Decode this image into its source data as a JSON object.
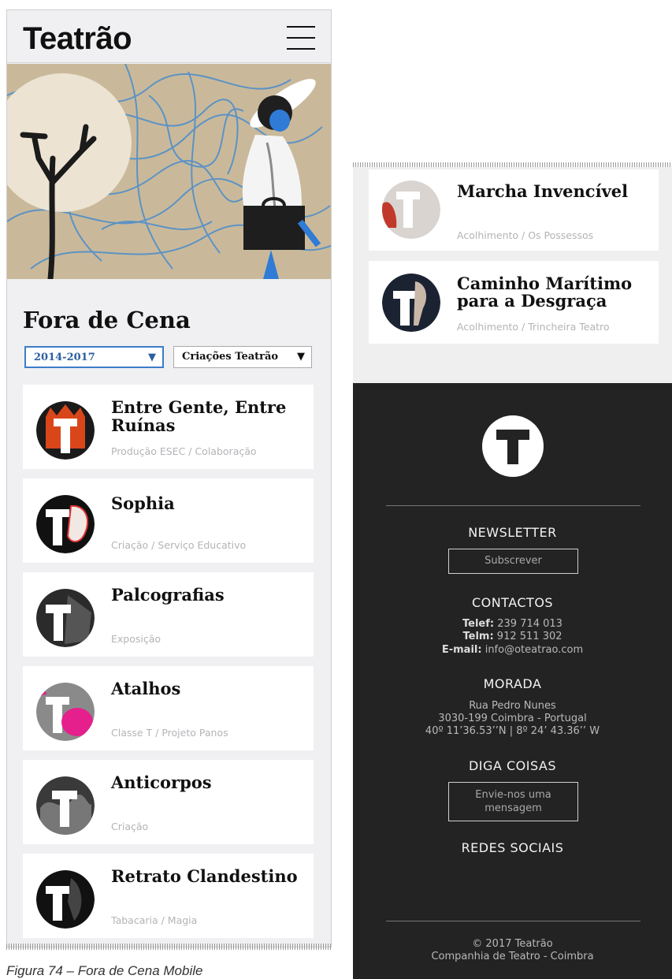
{
  "header": {
    "logo": "Teatrão",
    "menu_icon": "hamburger-menu-icon"
  },
  "section": {
    "title": "Fora de Cena"
  },
  "filters": {
    "years": {
      "value": "2014-2017",
      "arrow": "▼"
    },
    "category": {
      "value": "Criações Teatrão",
      "arrow": "▼"
    }
  },
  "cards": [
    {
      "title_line1": "Entre Gente, Entre",
      "title_line2": "Ruínas",
      "subtitle": "Produção ESEC / Colaboração"
    },
    {
      "title_line1": "Sophia",
      "subtitle": "Criação / Serviço Educativo"
    },
    {
      "title_line1": "Palcografias",
      "subtitle": "Exposição"
    },
    {
      "title_line1": "Atalhos",
      "subtitle": "Classe T / Projeto Panos"
    },
    {
      "title_line1": "Anticorpos",
      "subtitle": "Criação"
    },
    {
      "title_line1": "Retrato Clandestino",
      "subtitle": "Tabacaria / Magia"
    }
  ],
  "caption": "Figura 74 – Fora de Cena Mobile",
  "right_cards": [
    {
      "title_line1": "Marcha Invencível",
      "subtitle": "Acolhimento / Os Possessos"
    },
    {
      "title_line1": "Caminho Marítimo",
      "title_line2": "para a Desgraça",
      "subtitle": "Acolhimento / Trincheira Teatro"
    }
  ],
  "footer": {
    "newsletter": {
      "heading": "NEWSLETTER",
      "button": "Subscrever"
    },
    "contacts": {
      "heading": "CONTACTOS",
      "phone_label": "Telef:",
      "phone": "239 714 013",
      "mobile_label": "Telm:",
      "mobile": "912 511 302",
      "email_label": "E-mail:",
      "email": "info@oteatrao.com"
    },
    "address": {
      "heading": "MORADA",
      "line1": "Rua Pedro Nunes",
      "line2": "3030-199 Coimbra - Portugal",
      "line3": "40º 11’36.53’’N | 8º 24’ 43.36’’ W"
    },
    "message": {
      "heading": "DIGA COISAS",
      "button_line1": "Envie-nos uma",
      "button_line2": "mensagem"
    },
    "social": {
      "heading": "REDES SOCIAIS"
    },
    "copyright": "© 2017 Teatrão",
    "company": "Companhia de Teatro - Coimbra"
  },
  "colors": {
    "accent_blue": "#3d7cc9",
    "footer_bg": "#232323",
    "hero_bg": "#c9b99a"
  }
}
